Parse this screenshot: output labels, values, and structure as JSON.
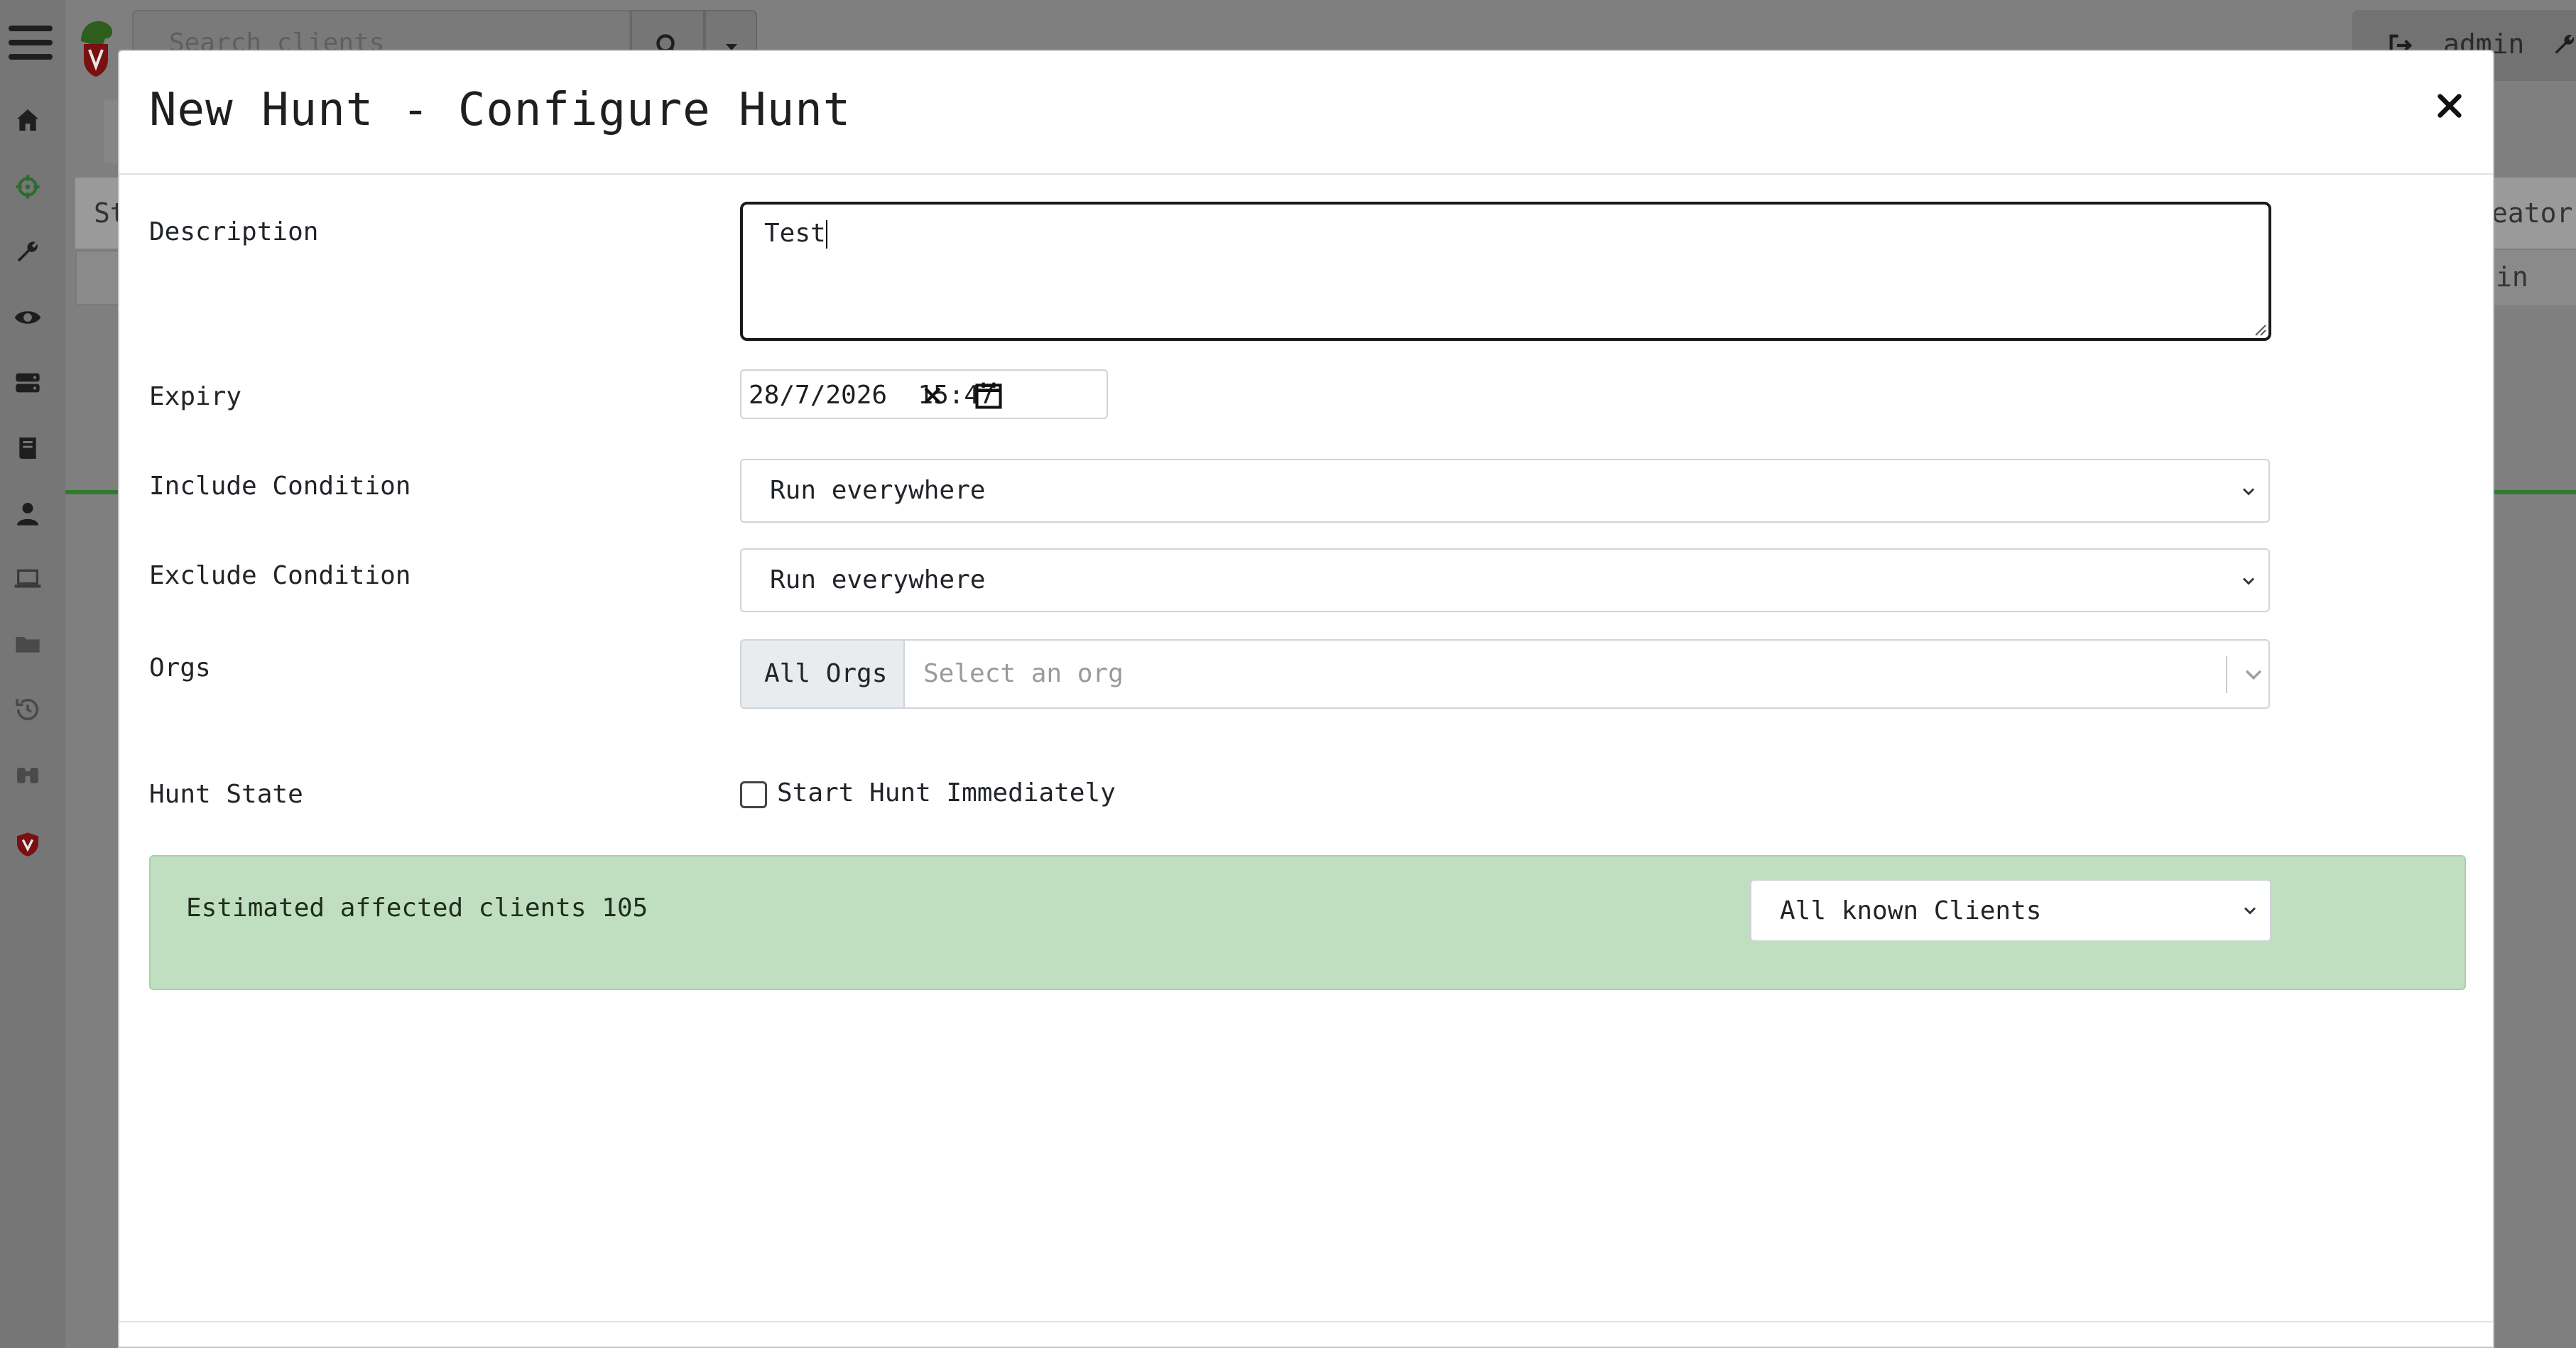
{
  "background": {
    "search_placeholder": "Search clients",
    "user_name": "admin",
    "table_head_left": "St",
    "table_head_right": "eator",
    "table_cell_right": "in",
    "nav_icons": [
      "home-icon",
      "crosshair-icon",
      "wrench-icon",
      "eye-icon",
      "server-icon",
      "book-icon",
      "user-icon",
      "laptop-icon",
      "folder-icon",
      "history-icon",
      "binoculars-icon",
      "shield-logo-icon"
    ]
  },
  "modal": {
    "title": "New Hunt - Configure Hunt",
    "description": {
      "label": "Description",
      "value": "Test"
    },
    "expiry": {
      "label": "Expiry",
      "value": "28/7/2026  15:47"
    },
    "include_condition": {
      "label": "Include Condition",
      "selected": "Run everywhere"
    },
    "exclude_condition": {
      "label": "Exclude Condition",
      "selected": "Run everywhere"
    },
    "orgs": {
      "label": "Orgs",
      "addon": "All Orgs",
      "placeholder": "Select an org"
    },
    "hunt_state": {
      "label": "Hunt State",
      "checkbox_label": "Start Hunt Immediately",
      "checked": false
    },
    "estimate": {
      "text": "Estimated affected clients 105",
      "selected": "All known Clients"
    }
  },
  "colors": {
    "alert_bg": "#c0dfc0",
    "accent_green": "#2f7a2f",
    "overlay": "#7f7f7f"
  }
}
